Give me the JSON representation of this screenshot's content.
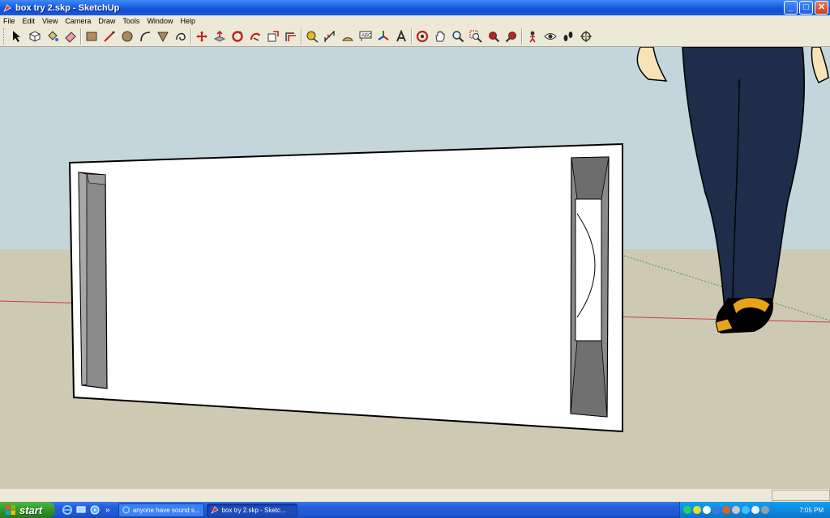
{
  "window": {
    "title": "box try 2.skp - SketchUp",
    "controls": {
      "minimize": "_",
      "maximize": "□",
      "close": "✕"
    }
  },
  "menu": [
    "File",
    "Edit",
    "View",
    "Camera",
    "Draw",
    "Tools",
    "Window",
    "Help"
  ],
  "toolbar": {
    "groups": [
      [
        "select-icon",
        "make-component-icon",
        "paint-bucket-icon",
        "eraser-icon"
      ],
      [
        "rectangle-icon",
        "line-icon",
        "circle-icon",
        "arc-icon",
        "polygon-icon",
        "freehand-icon"
      ],
      [
        "move-icon",
        "push-pull-icon",
        "rotate-icon",
        "follow-me-icon",
        "scale-icon",
        "offset-icon"
      ],
      [
        "tape-measure-icon",
        "dimension-icon",
        "protractor-icon",
        "text-icon",
        "axes-icon",
        "3d-text-icon"
      ],
      [
        "orbit-icon",
        "pan-icon",
        "zoom-icon",
        "zoom-window-icon",
        "zoom-extents-icon",
        "previous-view-icon"
      ],
      [
        "position-camera-icon",
        "look-around-icon",
        "walk-icon",
        "section-plane-icon"
      ]
    ]
  },
  "scene": {
    "sky_color": "#c5d5dc",
    "ground_color": "#cdc9b3",
    "box_face_color": "#ffffff",
    "port_color": "#8a8a8a",
    "figure_pants_color": "#1f2d4b",
    "figure_skin_color": "#f6e4b8",
    "figure_shoe_color": "#e8a418"
  },
  "taskbar": {
    "start_label": "start",
    "quick_launch_more": "»",
    "tasks": [
      {
        "label": "anyone have sound s...",
        "active": false
      },
      {
        "label": "box try 2.skp - Sketc...",
        "active": true
      }
    ],
    "clock": "7:05 PM"
  }
}
